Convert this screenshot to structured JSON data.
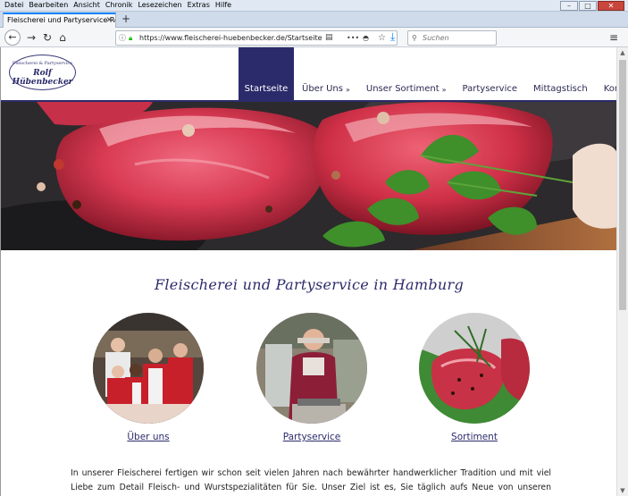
{
  "browser": {
    "menu": [
      "Datei",
      "Bearbeiten",
      "Ansicht",
      "Chronik",
      "Lesezeichen",
      "Extras",
      "Hilfe"
    ],
    "tab_title": "Fleischerei und Partyservice Rolf Hü",
    "url": "https://www.fleischerei-huebenbecker.de/Startseite",
    "search_placeholder": "Suchen"
  },
  "site": {
    "logo_line1": "Fleischerei & Partyservice",
    "logo_line2": "Rolf Hübenbecker",
    "nav": [
      {
        "label": "Startseite",
        "active": true,
        "submenu": false
      },
      {
        "label": "Über Uns",
        "active": false,
        "submenu": true
      },
      {
        "label": "Unser Sortiment",
        "active": false,
        "submenu": true
      },
      {
        "label": "Partyservice",
        "active": false,
        "submenu": false
      },
      {
        "label": "Mittagstisch",
        "active": false,
        "submenu": false
      },
      {
        "label": "Kontakt",
        "active": false,
        "submenu": true
      }
    ],
    "heading": "Fleischerei und Partyservice in Hamburg",
    "features": [
      {
        "label": "Über uns"
      },
      {
        "label": "Partyservice"
      },
      {
        "label": "Sortiment"
      }
    ],
    "intro": "In unserer Fleischerei fertigen wir schon seit vielen Jahren nach bewährter handwerklicher Tradition und mit viel Liebe zum Detail Fleisch- und Wurstspezialitäten für Sie. Unser Ziel ist es, Sie täglich aufs Neue von unseren hochwertigen Produkten zu"
  },
  "colors": {
    "brand": "#2b2b6b",
    "accent": "#0a84ff"
  }
}
